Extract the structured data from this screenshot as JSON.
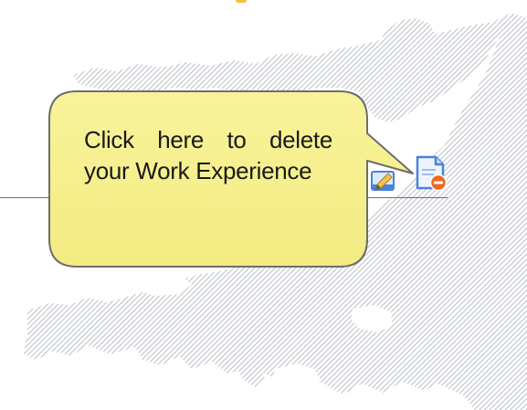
{
  "tooltip": {
    "text": "Click here to delete your Work Experience"
  },
  "actions": {
    "edit_icon": "edit-document-icon",
    "delete_icon": "delete-document-icon"
  },
  "colors": {
    "tooltip_fill": "#f6f08f",
    "tooltip_border": "#6d6d6d",
    "map_hatch": "#b9bfc6",
    "delete_badge": "#ee6a24",
    "icon_blue": "#4a84d8"
  }
}
